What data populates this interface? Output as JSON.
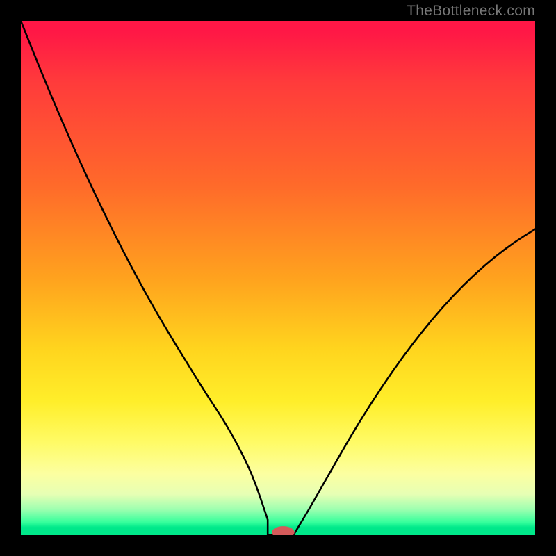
{
  "watermark": {
    "text": "TheBottleneck.com"
  },
  "chart_data": {
    "type": "line",
    "title": "",
    "xlabel": "",
    "ylabel": "",
    "xlim": [
      0,
      100
    ],
    "ylim": [
      0,
      100
    ],
    "grid": false,
    "legend": false,
    "x": [
      0,
      4,
      8,
      12,
      16,
      20,
      24,
      28,
      32,
      36,
      40,
      44,
      46,
      48,
      50,
      52,
      56,
      60,
      64,
      68,
      72,
      76,
      80,
      84,
      88,
      92,
      96,
      100
    ],
    "y": [
      100,
      90,
      80.5,
      71.5,
      63,
      55,
      47.5,
      40.5,
      34,
      27.5,
      21.5,
      14,
      9,
      3,
      0,
      0,
      5,
      12,
      19,
      25.5,
      31.5,
      37,
      42,
      46.5,
      50.5,
      54,
      57,
      59.5
    ],
    "notch": {
      "x": 51,
      "radius_x": 2.2,
      "radius_y": 1.2
    },
    "flat_bottom": {
      "x_start": 48,
      "x_end": 53,
      "y": 0
    },
    "background": {
      "type": "vertical-gradient",
      "stops": [
        {
          "pos": 0,
          "color": "#ff1746"
        },
        {
          "pos": 0.5,
          "color": "#ffa21e"
        },
        {
          "pos": 0.82,
          "color": "#fffb66"
        },
        {
          "pos": 0.95,
          "color": "#9dffb0"
        },
        {
          "pos": 1.0,
          "color": "#00e88a"
        }
      ]
    }
  }
}
